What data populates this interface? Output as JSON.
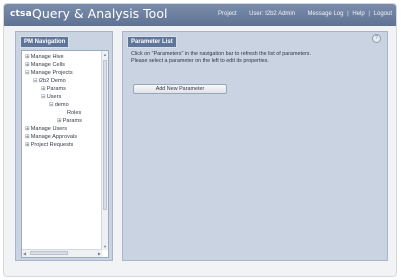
{
  "header": {
    "brand": "ctsa",
    "title": "Query & Analysis Tool",
    "nav": {
      "project": "Project",
      "user": "User: I2b2 Admin",
      "message_log": "Message Log",
      "help": "Help",
      "logout": "Logout",
      "separator": "|"
    }
  },
  "left_panel": {
    "tab_label": "PM Navigation",
    "tree": [
      {
        "toggle": "⊞",
        "label": "Manage Hive"
      },
      {
        "toggle": "⊞",
        "label": "Manage Cells"
      },
      {
        "toggle": "⊟",
        "label": "Manage Projects"
      },
      {
        "toggle": "⊟",
        "label": "i2b2 Demo"
      },
      {
        "toggle": "⊞",
        "label": "Params"
      },
      {
        "toggle": "⊟",
        "label": "Users"
      },
      {
        "toggle": "⊟",
        "label": "demo"
      },
      {
        "toggle": "",
        "label": "Roles"
      },
      {
        "toggle": "⊞",
        "label": "Params"
      },
      {
        "toggle": "⊞",
        "label": "Manage Users"
      },
      {
        "toggle": "⊞",
        "label": "Manage Approvals"
      },
      {
        "toggle": "⊞",
        "label": "Project Requests"
      }
    ]
  },
  "right_panel": {
    "tab_label": "Parameter List",
    "help_icon": "?",
    "instruction_1": "Click on \"Parameters\" in the navigation bar to refresh the list of parameters.",
    "instruction_2": "Please select a parameter on the left to edit its properties.",
    "add_button_label": "Add New Parameter"
  }
}
